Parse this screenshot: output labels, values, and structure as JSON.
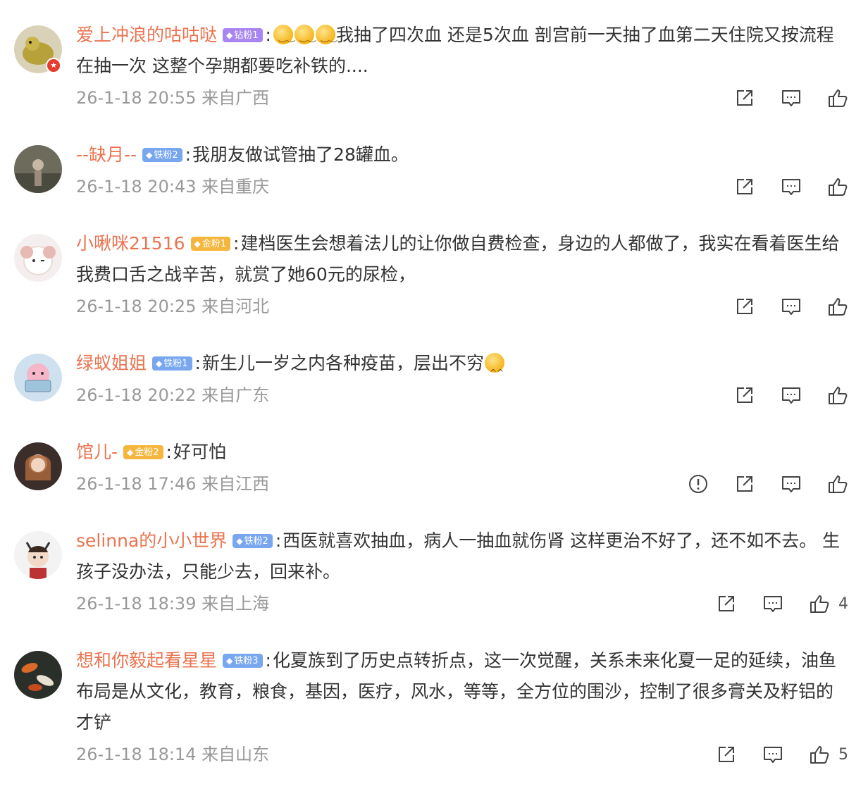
{
  "comments": [
    {
      "username": "爱上冲浪的咕咕哒",
      "fan_badge": {
        "type": "diamond",
        "label": "钻粉1"
      },
      "text_parts": [
        "我抽了四次血 还是5次血 剖宫前一天抽了血第二天住院又按流程在抽一次 这整个孕期都要吃补铁的...."
      ],
      "emojis": [
        "😥",
        "😥",
        "😥"
      ],
      "time": "26-1-18 20:55",
      "location": "来自广西",
      "like_count": ""
    },
    {
      "username": "--缺月--",
      "fan_badge": {
        "type": "iron",
        "label": "铁粉2"
      },
      "text": "我朋友做试管抽了28罐血。",
      "time": "26-1-18 20:43",
      "location": "来自重庆",
      "like_count": ""
    },
    {
      "username": "小啾咪21516",
      "fan_badge": {
        "type": "gold",
        "label": "金粉1"
      },
      "text": "建档医生会想着法儿的让你做自费检查，身边的人都做了，我实在看着医生给我费口舌之战辛苦，就赏了她60元的尿检，",
      "time": "26-1-18 20:25",
      "location": "来自河北",
      "like_count": ""
    },
    {
      "username": "绿蚁姐姐",
      "fan_badge": {
        "type": "iron",
        "label": "铁粉1"
      },
      "text": "新生儿一岁之内各种疫苗，层出不穷",
      "time": "26-1-18 20:22",
      "location": "来自广东",
      "like_count": ""
    },
    {
      "username": "馆儿-",
      "fan_badge": {
        "type": "gold",
        "label": "金粉2"
      },
      "text": "好可怕",
      "time": "26-1-18 17:46",
      "location": "来自江西",
      "like_count": ""
    },
    {
      "username": "selinna的小小世界",
      "fan_badge": {
        "type": "iron",
        "label": "铁粉2"
      },
      "text": "西医就喜欢抽血，病人一抽血就伤肾  这样更治不好了，还不如不去。 生孩子没办法，只能少去，回来补。",
      "time": "26-1-18 18:39",
      "location": "来自上海",
      "like_count": "4"
    },
    {
      "username": "想和你毅起看星星",
      "fan_badge": {
        "type": "iron",
        "label": "铁粉3"
      },
      "text": "化夏族到了历史点转折点，这一次觉醒，关系未来化夏一足的延续，油鱼布局是从文化，教育，粮食，基因，医疗，风水，等等，全方位的围沙，控制了很多膏关及籽铝的才铲",
      "time": "26-1-18 18:14",
      "location": "来自山东",
      "like_count": "5"
    }
  ],
  "colors": {
    "username": "#eb7350",
    "text": "#333333",
    "meta": "#999999",
    "diamond_badge": "#a985f2",
    "iron_badge": "#78a7ef",
    "gold_badge": "#f5b63e",
    "verified_badge": "#e63b2e"
  },
  "icons": {
    "share": "share-icon",
    "comment": "comment-icon",
    "like": "like-icon",
    "report": "report-icon",
    "emoji_laugh": "😂"
  }
}
